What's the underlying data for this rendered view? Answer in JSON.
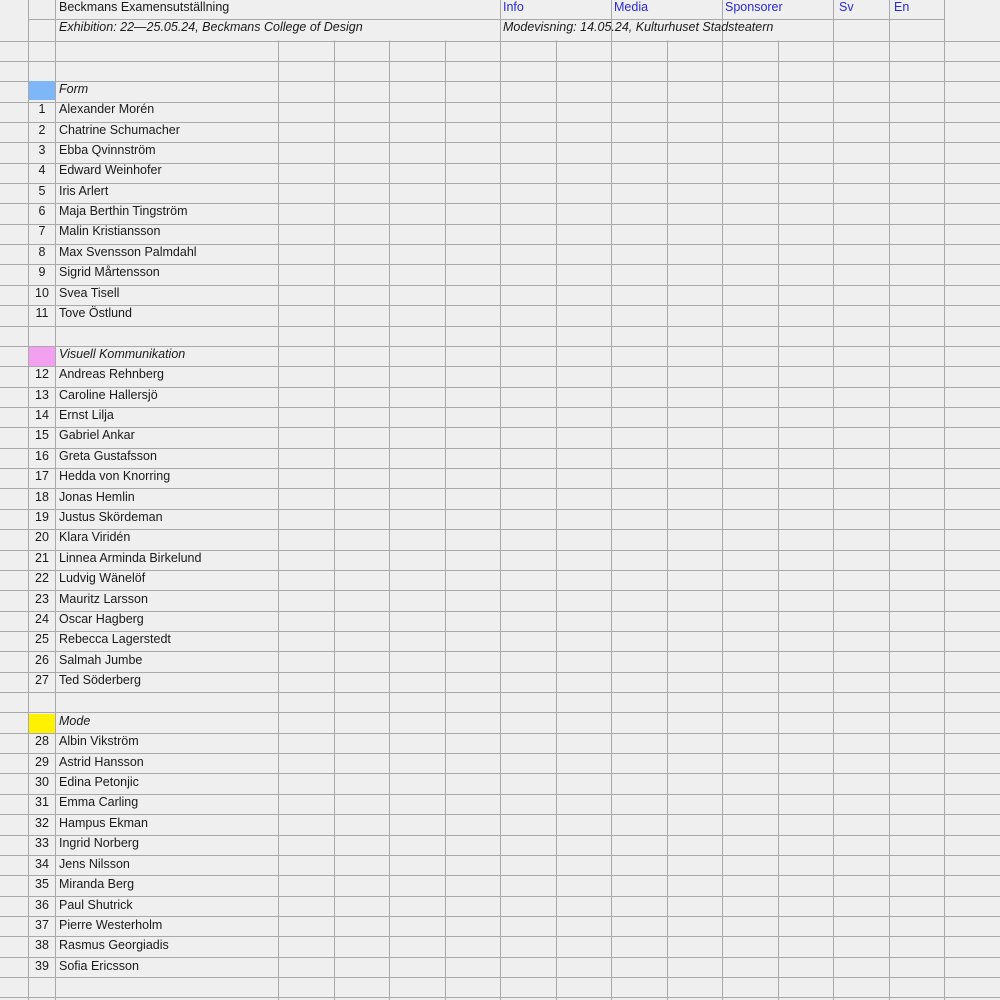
{
  "header": {
    "title": "Beckmans Examensutställning",
    "exhibition": "Exhibition: 22—25.05.24, Beckmans College of Design",
    "fashion_show": "Modevisning: 14.05.24, Kulturhuset Stadsteatern",
    "nav": {
      "info": "Info",
      "media": "Media",
      "sponsors": "Sponsorer",
      "lang_sv": "Sv",
      "lang_en": "En"
    },
    "link_color": "#2b2bd0"
  },
  "sections": [
    {
      "name": "Form",
      "color": "#7fb6f7",
      "students": [
        {
          "num": "1",
          "name": "Alexander Morén"
        },
        {
          "num": "2",
          "name": "Chatrine Schumacher"
        },
        {
          "num": "3",
          "name": "Ebba Qvinnström"
        },
        {
          "num": "4",
          "name": "Edward Weinhofer"
        },
        {
          "num": "5",
          "name": "Iris Arlert"
        },
        {
          "num": "6",
          "name": "Maja Berthin Tingström"
        },
        {
          "num": "7",
          "name": "Malin Kristiansson"
        },
        {
          "num": "8",
          "name": "Max Svensson Palmdahl"
        },
        {
          "num": "9",
          "name": "Sigrid Mårtensson"
        },
        {
          "num": "10",
          "name": "Svea Tisell"
        },
        {
          "num": "11",
          "name": "Tove Östlund"
        }
      ]
    },
    {
      "name": "Visuell Kommunikation",
      "color": "#f3a0f0",
      "students": [
        {
          "num": "12",
          "name": "Andreas Rehnberg"
        },
        {
          "num": "13",
          "name": "Caroline Hallersjö"
        },
        {
          "num": "14",
          "name": "Ernst Lilja"
        },
        {
          "num": "15",
          "name": "Gabriel Ankar"
        },
        {
          "num": "16",
          "name": "Greta Gustafsson"
        },
        {
          "num": "17",
          "name": "Hedda von Knorring"
        },
        {
          "num": "18",
          "name": "Jonas Hemlin"
        },
        {
          "num": "19",
          "name": "Justus Skördeman"
        },
        {
          "num": "20",
          "name": "Klara Viridén"
        },
        {
          "num": "21",
          "name": "Linnea Arminda Birkelund"
        },
        {
          "num": "22",
          "name": "Ludvig Wänelöf"
        },
        {
          "num": "23",
          "name": "Mauritz Larsson"
        },
        {
          "num": "24",
          "name": "Oscar Hagberg"
        },
        {
          "num": "25",
          "name": "Rebecca Lagerstedt"
        },
        {
          "num": "26",
          "name": "Salmah Jumbe"
        },
        {
          "num": "27",
          "name": "Ted Söderberg"
        }
      ]
    },
    {
      "name": "Mode",
      "color": "#fff200",
      "students": [
        {
          "num": "28",
          "name": "Albin Vikström"
        },
        {
          "num": "29",
          "name": "Astrid Hansson"
        },
        {
          "num": "30",
          "name": "Edina Petonjic"
        },
        {
          "num": "31",
          "name": "Emma Carling"
        },
        {
          "num": "32",
          "name": "Hampus Ekman"
        },
        {
          "num": "33",
          "name": "Ingrid Norberg"
        },
        {
          "num": "34",
          "name": "Jens Nilsson"
        },
        {
          "num": "35",
          "name": "Miranda Berg"
        },
        {
          "num": "36",
          "name": "Paul Shutrick"
        },
        {
          "num": "37",
          "name": "Pierre Westerholm"
        },
        {
          "num": "38",
          "name": "Rasmus Georgiadis"
        },
        {
          "num": "39",
          "name": "Sofia Ericsson"
        }
      ]
    }
  ]
}
